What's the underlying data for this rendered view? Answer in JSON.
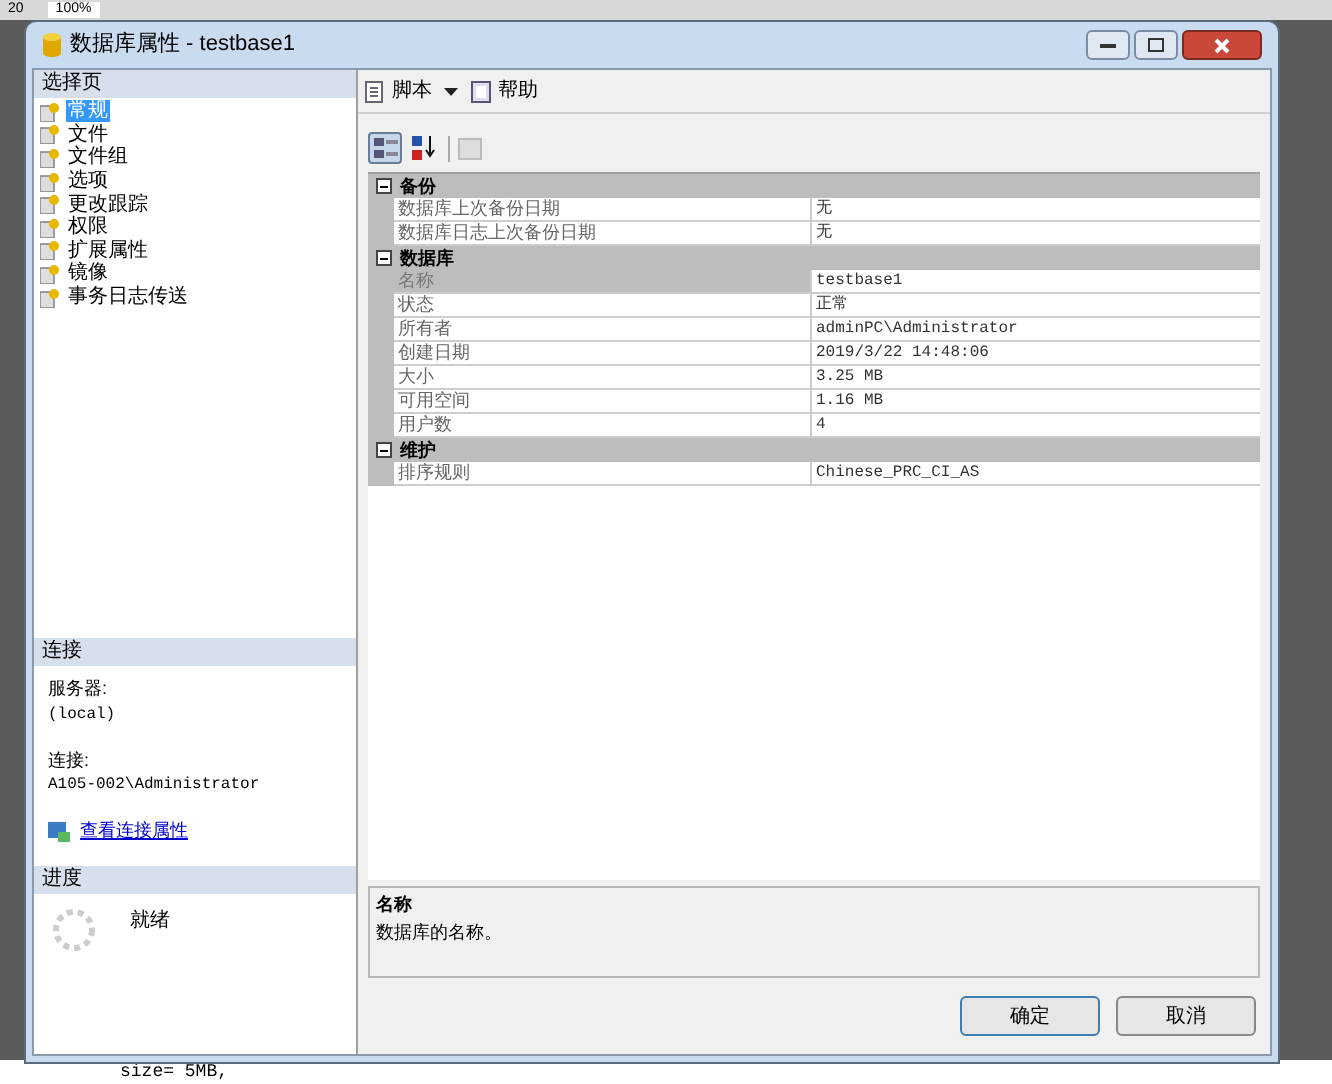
{
  "background": {
    "number": "20",
    "zoom": "100%",
    "code_line": "size= 5MB,"
  },
  "window": {
    "title": "数据库属性 - testbase1"
  },
  "sidebar": {
    "header": "选择页",
    "items": [
      {
        "label": "常规",
        "selected": true
      },
      {
        "label": "文件",
        "selected": false
      },
      {
        "label": "文件组",
        "selected": false
      },
      {
        "label": "选项",
        "selected": false
      },
      {
        "label": "更改跟踪",
        "selected": false
      },
      {
        "label": "权限",
        "selected": false
      },
      {
        "label": "扩展属性",
        "selected": false
      },
      {
        "label": "镜像",
        "selected": false
      },
      {
        "label": "事务日志传送",
        "selected": false
      }
    ]
  },
  "connection": {
    "header": "连接",
    "server_label": "服务器:",
    "server": "(local)",
    "connection_label": "连接:",
    "connection": "A105-002\\Administrator",
    "link": "查看连接属性"
  },
  "progress": {
    "header": "进度",
    "status": "就绪"
  },
  "toolbar": {
    "script": "脚本",
    "help": "帮助"
  },
  "sort_buttons": [
    {
      "kind": "categorized",
      "selected": true
    },
    {
      "kind": "alphabetical",
      "selected": false
    }
  ],
  "grid": {
    "categories": [
      {
        "name": "备份",
        "expanded": true,
        "properties": [
          {
            "name": "数据库上次备份日期",
            "value": "无",
            "selected": false
          },
          {
            "name": "数据库日志上次备份日期",
            "value": "无",
            "selected": false
          }
        ]
      },
      {
        "name": "数据库",
        "expanded": true,
        "properties": [
          {
            "name": "名称",
            "value": "testbase1",
            "selected": true
          },
          {
            "name": "状态",
            "value": "正常",
            "selected": false
          },
          {
            "name": "所有者",
            "value": "adminPC\\Administrator",
            "selected": false
          },
          {
            "name": "创建日期",
            "value": "2019/3/22 14:48:06",
            "selected": false
          },
          {
            "name": "大小",
            "value": "3.25 MB",
            "selected": false
          },
          {
            "name": "可用空间",
            "value": "1.16 MB",
            "selected": false
          },
          {
            "name": "用户数",
            "value": "4",
            "selected": false
          }
        ]
      },
      {
        "name": "维护",
        "expanded": true,
        "properties": [
          {
            "name": "排序规则",
            "value": "Chinese_PRC_CI_AS",
            "selected": false
          }
        ]
      }
    ]
  },
  "description": {
    "title": "名称",
    "text": "数据库的名称。"
  },
  "buttons": [
    "确定",
    "取消"
  ]
}
